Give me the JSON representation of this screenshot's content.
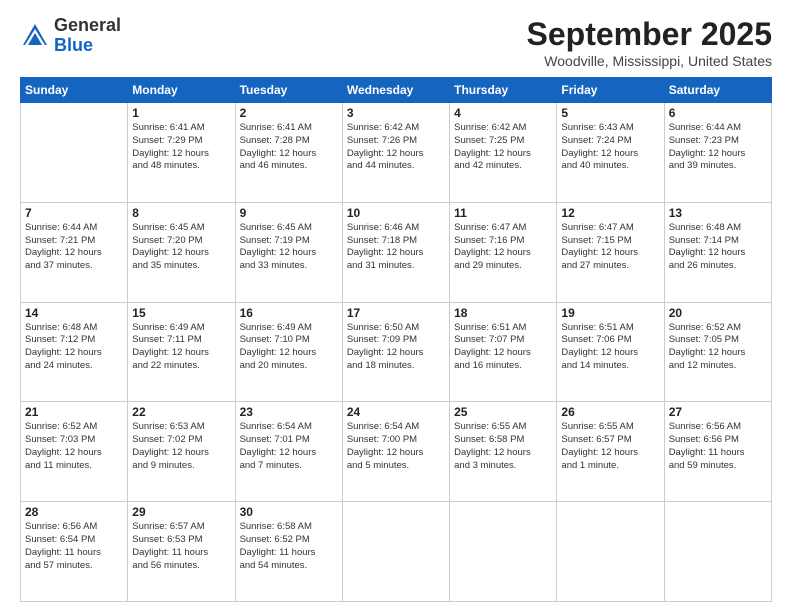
{
  "logo": {
    "general": "General",
    "blue": "Blue"
  },
  "header": {
    "month": "September 2025",
    "location": "Woodville, Mississippi, United States"
  },
  "weekdays": [
    "Sunday",
    "Monday",
    "Tuesday",
    "Wednesday",
    "Thursday",
    "Friday",
    "Saturday"
  ],
  "weeks": [
    [
      {
        "day": "",
        "info": ""
      },
      {
        "day": "1",
        "info": "Sunrise: 6:41 AM\nSunset: 7:29 PM\nDaylight: 12 hours\nand 48 minutes."
      },
      {
        "day": "2",
        "info": "Sunrise: 6:41 AM\nSunset: 7:28 PM\nDaylight: 12 hours\nand 46 minutes."
      },
      {
        "day": "3",
        "info": "Sunrise: 6:42 AM\nSunset: 7:26 PM\nDaylight: 12 hours\nand 44 minutes."
      },
      {
        "day": "4",
        "info": "Sunrise: 6:42 AM\nSunset: 7:25 PM\nDaylight: 12 hours\nand 42 minutes."
      },
      {
        "day": "5",
        "info": "Sunrise: 6:43 AM\nSunset: 7:24 PM\nDaylight: 12 hours\nand 40 minutes."
      },
      {
        "day": "6",
        "info": "Sunrise: 6:44 AM\nSunset: 7:23 PM\nDaylight: 12 hours\nand 39 minutes."
      }
    ],
    [
      {
        "day": "7",
        "info": "Sunrise: 6:44 AM\nSunset: 7:21 PM\nDaylight: 12 hours\nand 37 minutes."
      },
      {
        "day": "8",
        "info": "Sunrise: 6:45 AM\nSunset: 7:20 PM\nDaylight: 12 hours\nand 35 minutes."
      },
      {
        "day": "9",
        "info": "Sunrise: 6:45 AM\nSunset: 7:19 PM\nDaylight: 12 hours\nand 33 minutes."
      },
      {
        "day": "10",
        "info": "Sunrise: 6:46 AM\nSunset: 7:18 PM\nDaylight: 12 hours\nand 31 minutes."
      },
      {
        "day": "11",
        "info": "Sunrise: 6:47 AM\nSunset: 7:16 PM\nDaylight: 12 hours\nand 29 minutes."
      },
      {
        "day": "12",
        "info": "Sunrise: 6:47 AM\nSunset: 7:15 PM\nDaylight: 12 hours\nand 27 minutes."
      },
      {
        "day": "13",
        "info": "Sunrise: 6:48 AM\nSunset: 7:14 PM\nDaylight: 12 hours\nand 26 minutes."
      }
    ],
    [
      {
        "day": "14",
        "info": "Sunrise: 6:48 AM\nSunset: 7:12 PM\nDaylight: 12 hours\nand 24 minutes."
      },
      {
        "day": "15",
        "info": "Sunrise: 6:49 AM\nSunset: 7:11 PM\nDaylight: 12 hours\nand 22 minutes."
      },
      {
        "day": "16",
        "info": "Sunrise: 6:49 AM\nSunset: 7:10 PM\nDaylight: 12 hours\nand 20 minutes."
      },
      {
        "day": "17",
        "info": "Sunrise: 6:50 AM\nSunset: 7:09 PM\nDaylight: 12 hours\nand 18 minutes."
      },
      {
        "day": "18",
        "info": "Sunrise: 6:51 AM\nSunset: 7:07 PM\nDaylight: 12 hours\nand 16 minutes."
      },
      {
        "day": "19",
        "info": "Sunrise: 6:51 AM\nSunset: 7:06 PM\nDaylight: 12 hours\nand 14 minutes."
      },
      {
        "day": "20",
        "info": "Sunrise: 6:52 AM\nSunset: 7:05 PM\nDaylight: 12 hours\nand 12 minutes."
      }
    ],
    [
      {
        "day": "21",
        "info": "Sunrise: 6:52 AM\nSunset: 7:03 PM\nDaylight: 12 hours\nand 11 minutes."
      },
      {
        "day": "22",
        "info": "Sunrise: 6:53 AM\nSunset: 7:02 PM\nDaylight: 12 hours\nand 9 minutes."
      },
      {
        "day": "23",
        "info": "Sunrise: 6:54 AM\nSunset: 7:01 PM\nDaylight: 12 hours\nand 7 minutes."
      },
      {
        "day": "24",
        "info": "Sunrise: 6:54 AM\nSunset: 7:00 PM\nDaylight: 12 hours\nand 5 minutes."
      },
      {
        "day": "25",
        "info": "Sunrise: 6:55 AM\nSunset: 6:58 PM\nDaylight: 12 hours\nand 3 minutes."
      },
      {
        "day": "26",
        "info": "Sunrise: 6:55 AM\nSunset: 6:57 PM\nDaylight: 12 hours\nand 1 minute."
      },
      {
        "day": "27",
        "info": "Sunrise: 6:56 AM\nSunset: 6:56 PM\nDaylight: 11 hours\nand 59 minutes."
      }
    ],
    [
      {
        "day": "28",
        "info": "Sunrise: 6:56 AM\nSunset: 6:54 PM\nDaylight: 11 hours\nand 57 minutes."
      },
      {
        "day": "29",
        "info": "Sunrise: 6:57 AM\nSunset: 6:53 PM\nDaylight: 11 hours\nand 56 minutes."
      },
      {
        "day": "30",
        "info": "Sunrise: 6:58 AM\nSunset: 6:52 PM\nDaylight: 11 hours\nand 54 minutes."
      },
      {
        "day": "",
        "info": ""
      },
      {
        "day": "",
        "info": ""
      },
      {
        "day": "",
        "info": ""
      },
      {
        "day": "",
        "info": ""
      }
    ]
  ]
}
